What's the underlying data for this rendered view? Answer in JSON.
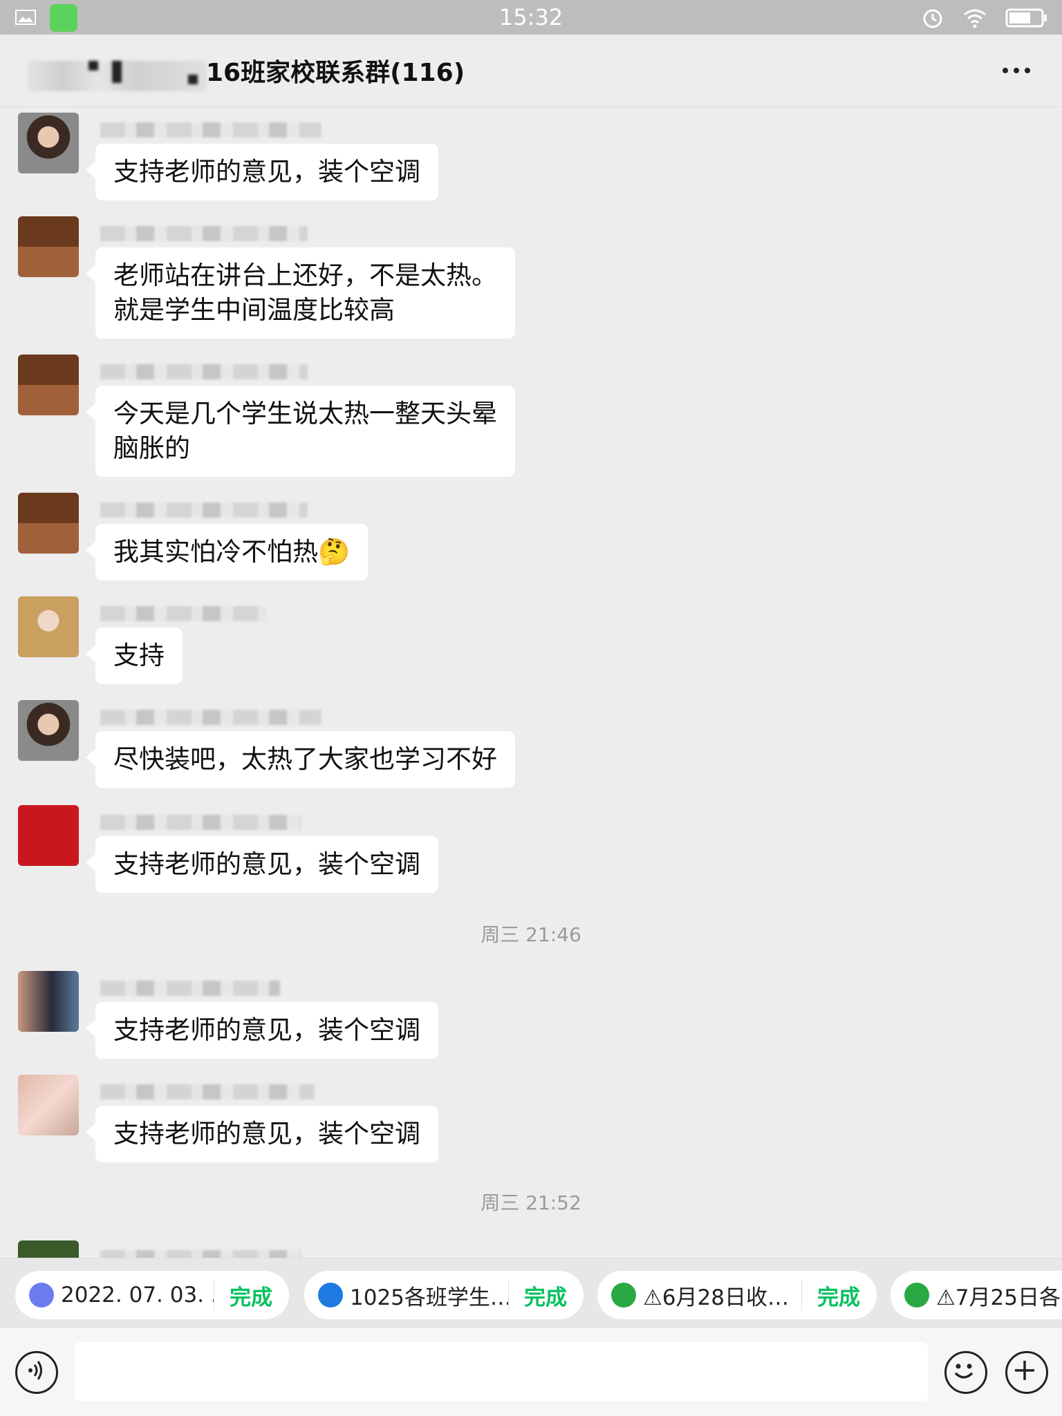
{
  "status_bar": {
    "time": "15:32"
  },
  "header": {
    "title": "16班家校联系群(116)"
  },
  "messages": [
    {
      "text": "支持老师的意见，装个空调"
    },
    {
      "text": "老师站在讲台上还好，不是太热。\n就是学生中间温度比较高"
    },
    {
      "text": "今天是几个学生说太热一整天头晕\n脑胀的"
    },
    {
      "text": "我其实怕冷不怕热",
      "emoji": "🤔"
    },
    {
      "text": "支持"
    },
    {
      "text": "尽快装吧，太热了大家也学习不好"
    },
    {
      "text": "支持老师的意见，装个空调"
    },
    {
      "text": "支持老师的意见，装个空调"
    },
    {
      "text": "支持老师的意见，装个空调"
    }
  ],
  "timestamps": [
    "周三 21:46",
    "周三 21:52"
  ],
  "chips": [
    {
      "label": "2022. 07. 03. . .",
      "status": "完成",
      "icon_color": "#6a7cf0"
    },
    {
      "label": "1025各班学生…",
      "status": "完成",
      "icon_color": "#1e7ae0"
    },
    {
      "label": "⚠6月28日收…",
      "status": "完成",
      "icon_color": "#2aa843"
    },
    {
      "label": "⚠7月25日各…",
      "status": "",
      "icon_color": "#2aa843"
    }
  ],
  "icons": {
    "voice": "voice-icon",
    "emoji": "emoji-icon",
    "add": "add-icon",
    "more": "more-icon"
  }
}
